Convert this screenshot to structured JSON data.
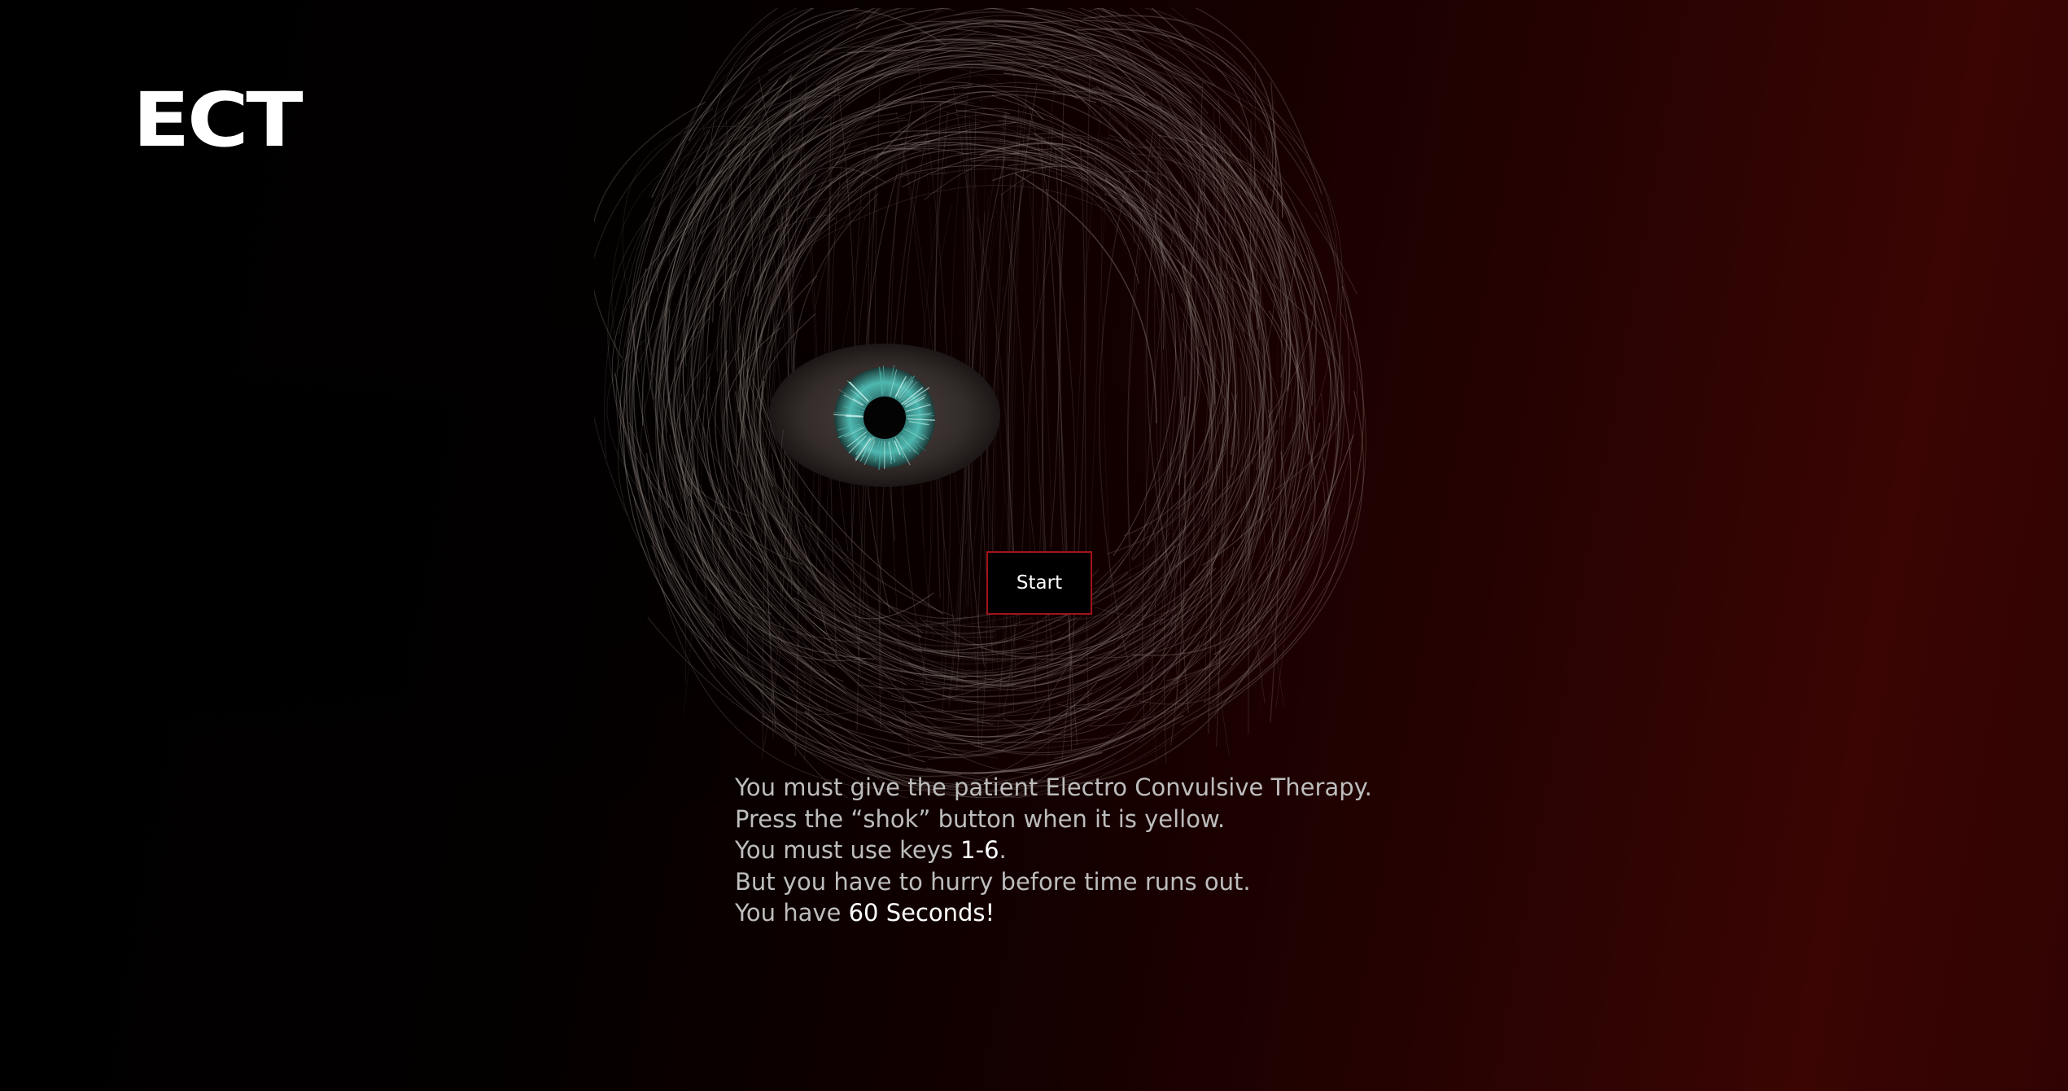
{
  "app": {
    "logo_text": "ECT"
  },
  "illustration": {
    "subject": "eye-in-hair",
    "hair_color": "#8a807a",
    "iris_color": "#4fb8b0",
    "sclera_color": "#3a3331"
  },
  "start_button": {
    "label": "Start",
    "border_color": "#a3131a"
  },
  "instructions": {
    "line1": "You must give the patient Electro Convulsive Therapy.",
    "line2": "Press the “shok” button when it is yellow.",
    "line3_prefix": "You must use keys ",
    "line3_keys": "1-6",
    "line3_suffix": ".",
    "line4": "But you have to hurry before time runs out.",
    "line5_prefix": "You have ",
    "line5_time": "60 Seconds!"
  },
  "colors": {
    "background_left": "#000000",
    "background_right": "#3a0503",
    "text": "#bdbdbd",
    "highlight_text": "#ffffff"
  }
}
